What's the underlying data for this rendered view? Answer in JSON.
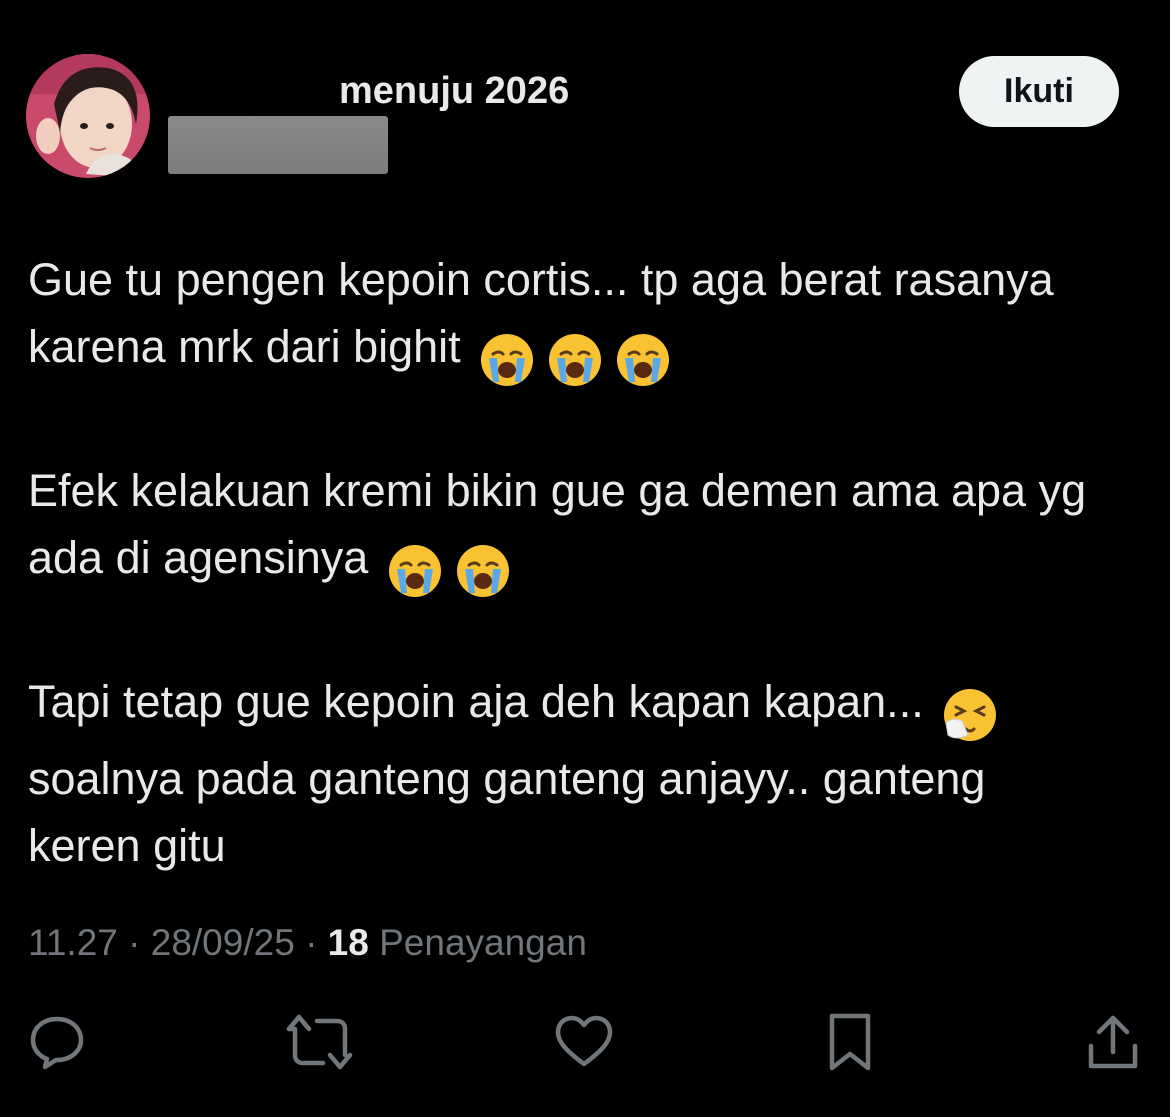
{
  "user": {
    "display_name": "menuju 2026",
    "avatar": "profile-photo"
  },
  "follow_button": {
    "label": "Ikuti"
  },
  "tweet": {
    "paragraphs": [
      {
        "lines": [
          "Gue tu pengen kepoin cortis... tp aga berat rasanya",
          "karena mrk dari bighit"
        ],
        "emoji": "😭😭😭"
      },
      {
        "lines": [
          "Efek kelakuan kremi bikin gue ga demen ama apa yg",
          "ada di agensinya"
        ],
        "emoji": "😭😭"
      },
      {
        "lines": [
          "Tapi tetap gue kepoin aja deh kapan kapan...",
          "soalnya pada ganteng ganteng anjayy.. ganteng",
          "keren gitu"
        ],
        "emoji": "🤧"
      }
    ]
  },
  "meta": {
    "time": "11.27",
    "separator": "·",
    "date": "28/09/25",
    "views_count": "18",
    "views_label": "Penayangan"
  },
  "actions": {
    "icons": [
      "reply-icon",
      "retweet-icon",
      "like-icon",
      "bookmark-icon",
      "share-icon"
    ]
  },
  "colors": {
    "background": "#000000",
    "text_primary": "#e7e9ea",
    "text_secondary": "#71767b",
    "follow_bg": "#eff3f4",
    "follow_text": "#0f1419"
  }
}
